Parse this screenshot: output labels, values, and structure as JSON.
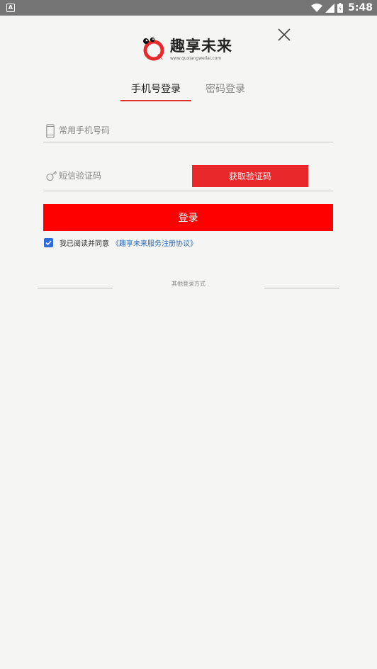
{
  "status_bar": {
    "notification_icon": "A",
    "time": "5:48"
  },
  "logo": {
    "brand": "趣享未来",
    "url": "www.quxiangweilai.com"
  },
  "tabs": [
    {
      "label": "手机号登录",
      "active": true
    },
    {
      "label": "密码登录",
      "active": false
    }
  ],
  "form": {
    "phone_placeholder": "常用手机号码",
    "sms_placeholder": "短信验证码",
    "get_code_label": "获取验证码",
    "login_label": "登录"
  },
  "agreement": {
    "checked": true,
    "text": "我已阅读并同意",
    "link": "《趣享未来服务注册协议》"
  },
  "other_login": {
    "label": "其他登录方式"
  },
  "colors": {
    "accent_red": "#fe0000",
    "button_red": "#e8282b",
    "link_blue": "#2b6cb4",
    "checkbox_blue": "#2e6cd8"
  },
  "icons": [
    "notification-icon",
    "wifi-icon",
    "signal-icon",
    "battery-icon",
    "close-icon",
    "logo-icon",
    "phone-icon",
    "key-icon",
    "check-icon"
  ]
}
